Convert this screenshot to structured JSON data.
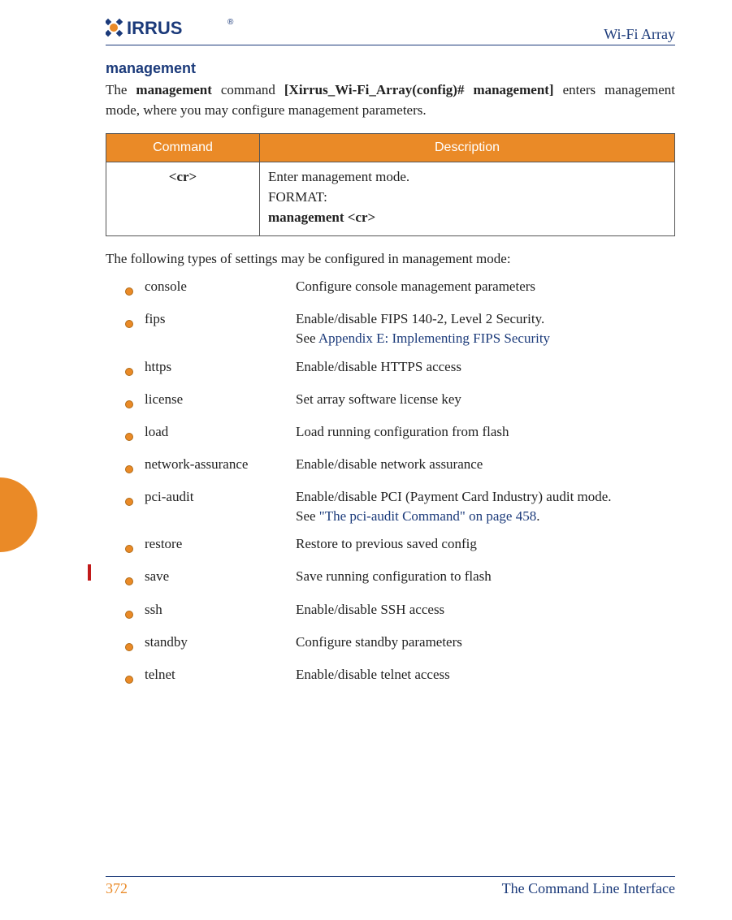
{
  "header": {
    "logo_text": "XIRRUS",
    "product": "Wi-Fi Array"
  },
  "section": {
    "heading": "management",
    "intro_pre": "The ",
    "intro_cmd": "management",
    "intro_mid": " command ",
    "intro_prompt": "[Xirrus_Wi-Fi_Array(config)# management]",
    "intro_post": " enters management mode, where you may configure management parameters."
  },
  "table": {
    "col1": "Command",
    "col2": "Description",
    "row_cmd": "<cr>",
    "row_desc_line1": "Enter management mode.",
    "row_desc_format_label": "FORMAT:",
    "row_desc_format_value": "management <cr>"
  },
  "followup": "The following types of settings may be configured in management mode:",
  "settings": [
    {
      "name": "console",
      "desc": "Configure console management parameters"
    },
    {
      "name": "fips",
      "desc": "Enable/disable FIPS 140-2, Level 2 Security.",
      "see_pre": "See ",
      "link": "Appendix E: Implementing FIPS Security"
    },
    {
      "name": "https",
      "desc": "Enable/disable HTTPS access"
    },
    {
      "name": "license",
      "desc": "Set array software license key"
    },
    {
      "name": "load",
      "desc": "Load running configuration from flash"
    },
    {
      "name": "network-assurance",
      "desc": "Enable/disable network assurance"
    },
    {
      "name": "pci-audit",
      "desc": "Enable/disable PCI (Payment Card Industry) audit mode.",
      "see_pre": "See ",
      "link": "\"The pci-audit Command\" on page 458",
      "post": "."
    },
    {
      "name": "restore",
      "desc": "Restore to previous saved config"
    },
    {
      "name": "save",
      "desc": "Save running configuration to flash"
    },
    {
      "name": "ssh",
      "desc": "Enable/disable SSH access"
    },
    {
      "name": "standby",
      "desc": "Configure standby parameters"
    },
    {
      "name": "telnet",
      "desc": "Enable/disable telnet access"
    }
  ],
  "footer": {
    "page": "372",
    "section": "The Command Line Interface"
  }
}
